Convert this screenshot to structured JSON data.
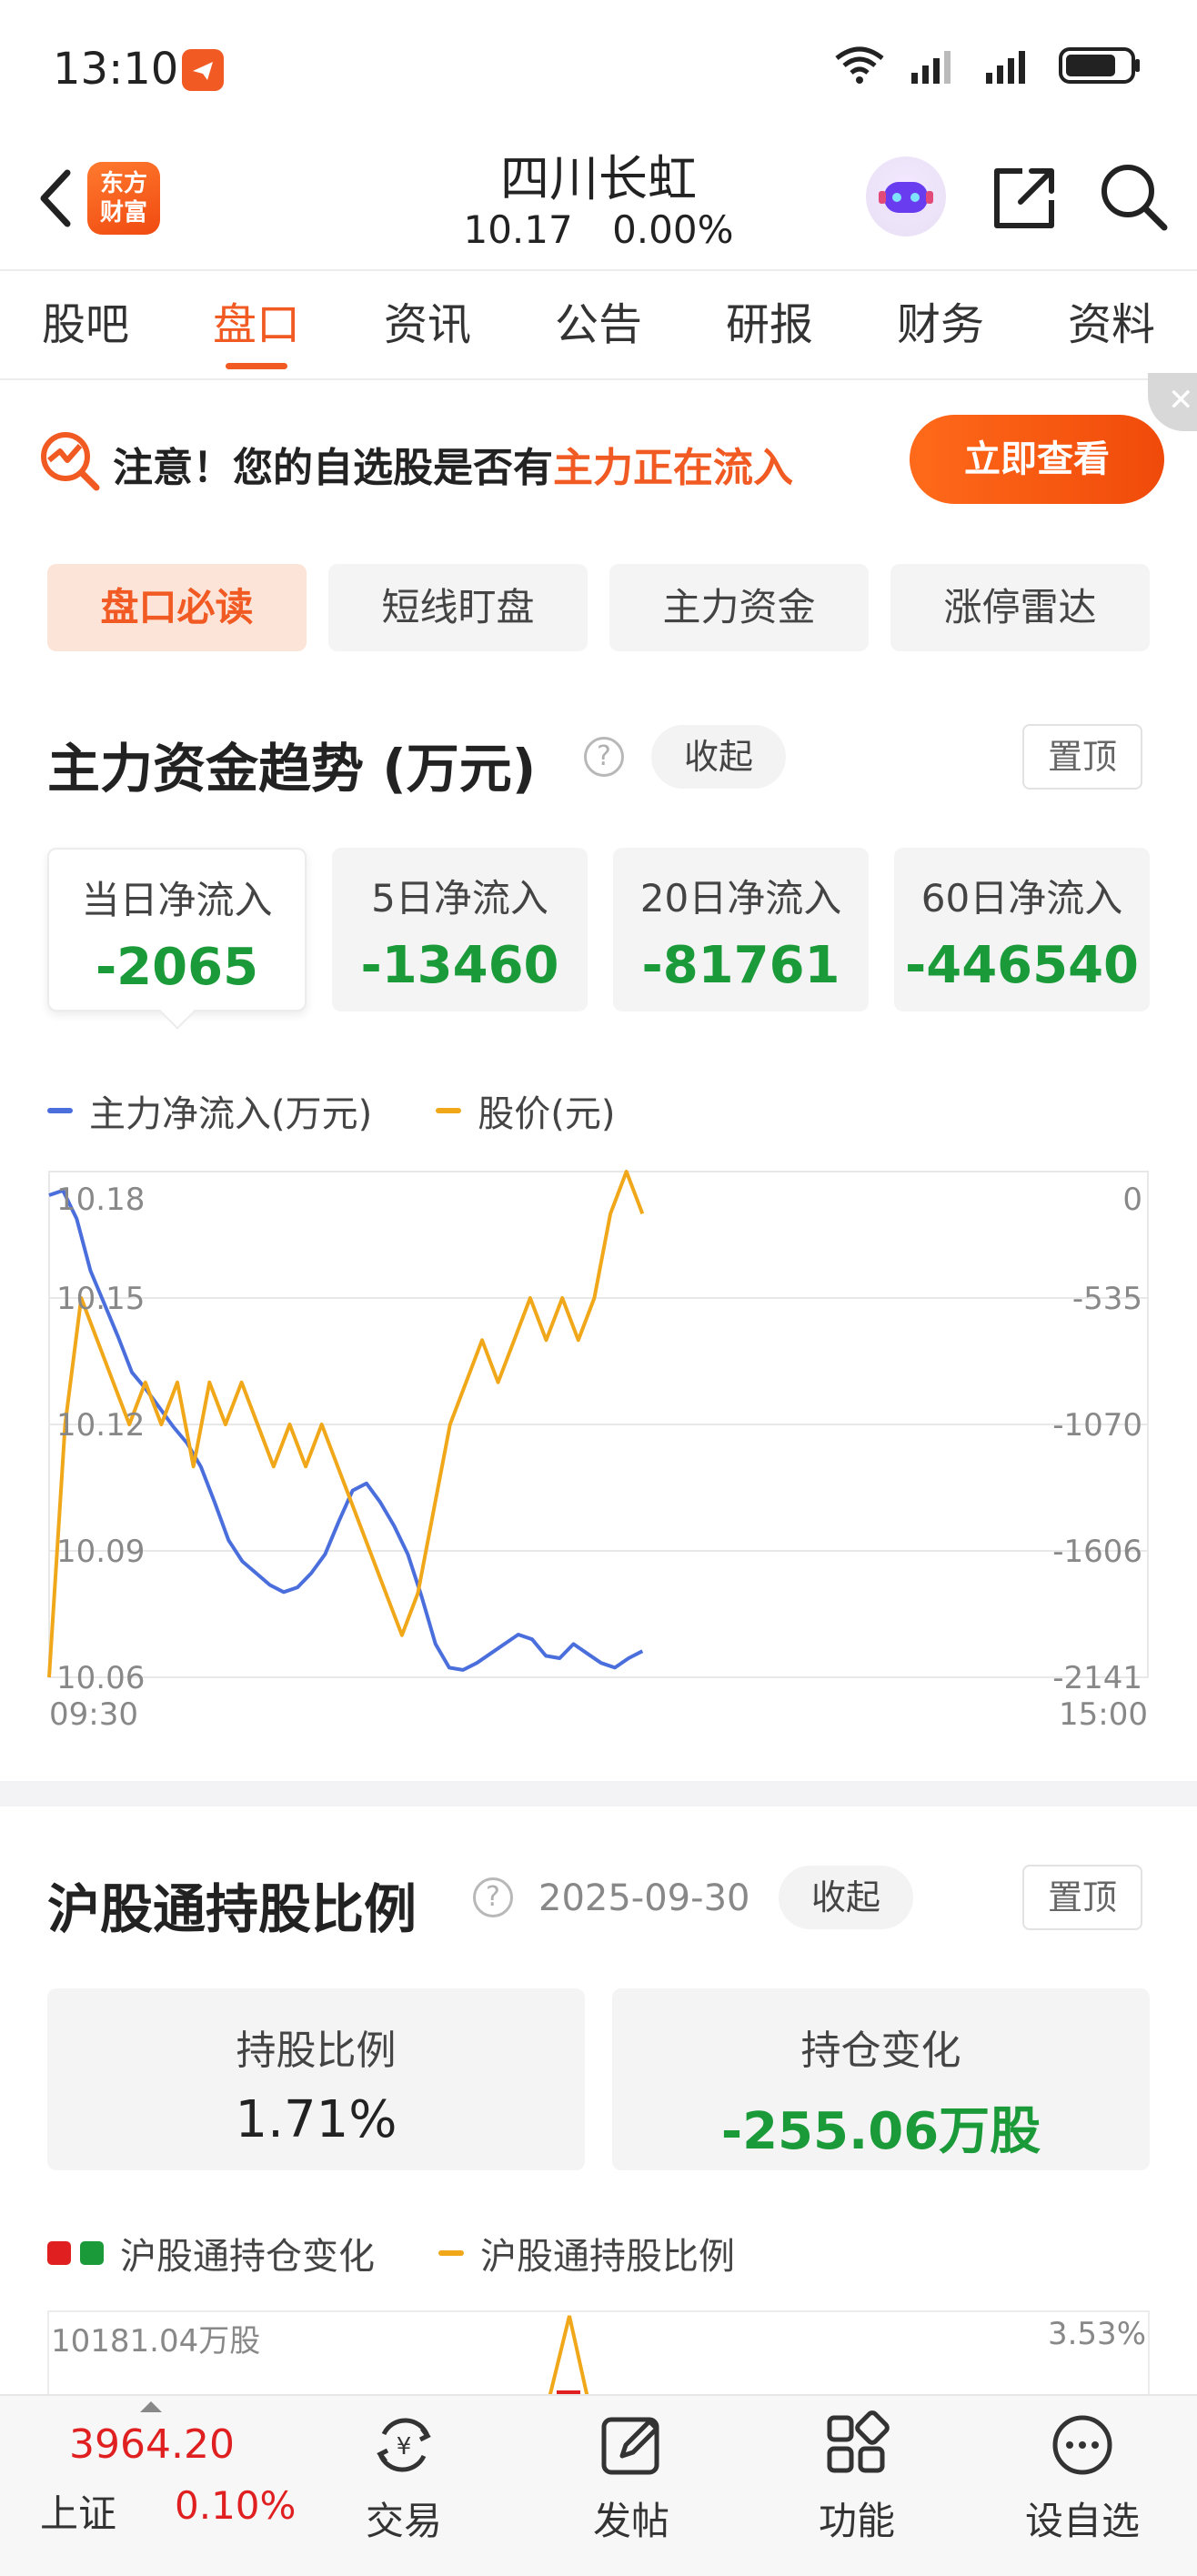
{
  "status": {
    "time": "13:10"
  },
  "header": {
    "logo_text": "东方财富",
    "stock_name": "四川长虹",
    "price": "10.17",
    "change_pct": "0.00%"
  },
  "tabs": [
    {
      "label": "股吧"
    },
    {
      "label": "盘口"
    },
    {
      "label": "资讯"
    },
    {
      "label": "公告"
    },
    {
      "label": "研报"
    },
    {
      "label": "财务"
    },
    {
      "label": "资料"
    }
  ],
  "banner": {
    "prefix": "注意！您的自选股是否有",
    "highlight": "主力正在流入",
    "button": "立即查看"
  },
  "subtabs": [
    {
      "label": "盘口必读"
    },
    {
      "label": "短线盯盘"
    },
    {
      "label": "主力资金"
    },
    {
      "label": "涨停雷达"
    }
  ],
  "fund_trend": {
    "title": "主力资金趋势 (万元)",
    "collapse": "收起",
    "pin": "置顶",
    "cards": [
      {
        "label": "当日净流入",
        "value": "-2065"
      },
      {
        "label": "5日净流入",
        "value": "-13460"
      },
      {
        "label": "20日净流入",
        "value": "-81761"
      },
      {
        "label": "60日净流入",
        "value": "-446540"
      }
    ],
    "legend": [
      {
        "name": "主力净流入(万元)",
        "color": "#4a6fdc"
      },
      {
        "name": "股价(元)",
        "color": "#f0a81a"
      }
    ]
  },
  "chart_data": {
    "type": "line",
    "x_labels": [
      "09:30",
      "15:00"
    ],
    "left_ticks": [
      "10.18",
      "10.15",
      "10.12",
      "10.09",
      "10.06"
    ],
    "right_ticks": [
      "0",
      "-535",
      "-1070",
      "-1606",
      "-2141"
    ],
    "ylim_price": [
      10.06,
      10.18
    ],
    "ylim_flow": [
      -2141,
      0
    ],
    "grid": true,
    "series": [
      {
        "name": "主力净流入(万元)",
        "color": "#4a6fdc",
        "axis": "right",
        "x_frac_end": 0.54,
        "values": [
          -100,
          -80,
          -200,
          -420,
          -560,
          -700,
          -850,
          -920,
          -1000,
          -1080,
          -1150,
          -1250,
          -1400,
          -1560,
          -1650,
          -1700,
          -1750,
          -1780,
          -1760,
          -1700,
          -1620,
          -1480,
          -1350,
          -1320,
          -1400,
          -1500,
          -1620,
          -1800,
          -2000,
          -2100,
          -2110,
          -2080,
          -2040,
          -2000,
          -1960,
          -1980,
          -2050,
          -2060,
          -2000,
          -2040,
          -2080,
          -2100,
          -2060,
          -2030
        ]
      },
      {
        "name": "股价(元)",
        "color": "#f0a81a",
        "axis": "left",
        "x_frac_end": 0.54,
        "values": [
          10.06,
          10.12,
          10.15,
          10.14,
          10.13,
          10.12,
          10.13,
          10.12,
          10.13,
          10.11,
          10.13,
          10.12,
          10.13,
          10.12,
          10.11,
          10.12,
          10.11,
          10.12,
          10.11,
          10.1,
          10.09,
          10.08,
          10.07,
          10.08,
          10.1,
          10.12,
          10.13,
          10.14,
          10.13,
          10.14,
          10.15,
          10.14,
          10.15,
          10.14,
          10.15,
          10.17,
          10.18,
          10.17
        ]
      }
    ]
  },
  "hk_connect": {
    "title": "沪股通持股比例",
    "date": "2025-09-30",
    "collapse": "收起",
    "pin": "置顶",
    "cards": [
      {
        "label": "持股比例",
        "value": "1.71%"
      },
      {
        "label": "持仓变化",
        "value": "-255.06万股"
      }
    ],
    "legend": [
      {
        "name": "沪股通持仓变化"
      },
      {
        "name": "沪股通持股比例"
      }
    ],
    "chart_top_left": "10181.04万股",
    "chart_top_right": "3.53%"
  },
  "bottom_bar": {
    "index_value": "3964.20",
    "index_name": "上证",
    "index_pct": "0.10%",
    "items": [
      {
        "label": "交易"
      },
      {
        "label": "发帖"
      },
      {
        "label": "功能"
      },
      {
        "label": "设自选"
      }
    ]
  }
}
